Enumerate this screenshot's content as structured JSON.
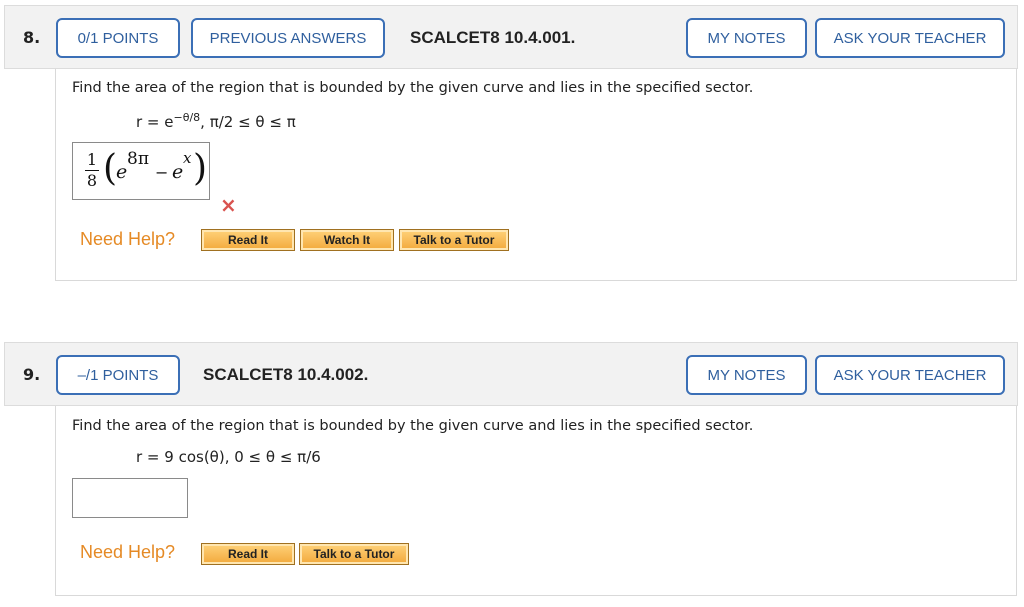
{
  "questions": [
    {
      "number": "8.",
      "points": "0/1 POINTS",
      "previous_answers": "PREVIOUS ANSWERS",
      "code": "SCALCET8 10.4.001.",
      "my_notes": "MY NOTES",
      "ask_teacher": "ASK YOUR TEACHER",
      "prompt": "Find the area of the region that is bounded by the given curve and lies in the specified sector.",
      "curve": "r = e",
      "curve_exp": "−θ/8",
      "sector": ",    π/2 ≤ θ ≤ π",
      "answer": {
        "coef_num": "1",
        "coef_den": "8",
        "term1_base": "e",
        "term1_exp": "8π",
        "minus": "−",
        "term2_base": "e",
        "term2_exp": "x"
      },
      "status_icon": "×",
      "need_help": "Need Help?",
      "help_buttons": [
        "Read It",
        "Watch It",
        "Talk to a Tutor"
      ]
    },
    {
      "number": "9.",
      "points": "–/1 POINTS",
      "code": "SCALCET8 10.4.002.",
      "my_notes": "MY NOTES",
      "ask_teacher": "ASK YOUR TEACHER",
      "prompt": "Find the area of the region that is bounded by the given curve and lies in the specified sector.",
      "curve": "r = 9 cos(θ),    0 ≤ θ ≤ π/6",
      "answer_value": "",
      "need_help": "Need Help?",
      "help_buttons": [
        "Read It",
        "Talk to a Tutor"
      ]
    }
  ],
  "colors": {
    "link_blue": "#2f5f9e",
    "help_orange": "#e58a25",
    "error_red": "#d9534f"
  }
}
